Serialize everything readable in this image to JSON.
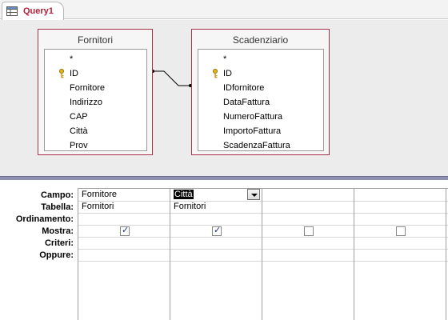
{
  "tab": {
    "label": "Query1",
    "icon": "query-icon"
  },
  "tables": [
    {
      "name": "Fornitori",
      "fields": [
        {
          "label": "*",
          "key": false
        },
        {
          "label": "ID",
          "key": true
        },
        {
          "label": "Fornitore",
          "key": false
        },
        {
          "label": "Indirizzo",
          "key": false
        },
        {
          "label": "CAP",
          "key": false
        },
        {
          "label": "Città",
          "key": false
        },
        {
          "label": "Prov",
          "key": false
        }
      ]
    },
    {
      "name": "Scadenziario",
      "fields": [
        {
          "label": "*",
          "key": false
        },
        {
          "label": "ID",
          "key": true
        },
        {
          "label": "IDfornitore",
          "key": false
        },
        {
          "label": "DataFattura",
          "key": false
        },
        {
          "label": "NumeroFattura",
          "key": false
        },
        {
          "label": "ImportoFattura",
          "key": false
        },
        {
          "label": "ScadenzaFattura",
          "key": false
        }
      ]
    }
  ],
  "grid": {
    "row_labels": [
      "Campo:",
      "Tabella:",
      "Ordinamento:",
      "Mostra:",
      "Criteri:",
      "Oppure:"
    ],
    "columns": [
      {
        "campo": "Fornitore",
        "tabella": "Fornitori",
        "mostra": true,
        "selected": false
      },
      {
        "campo": "Città",
        "tabella": "Fornitori",
        "mostra": true,
        "selected": true
      },
      {
        "campo": "",
        "tabella": "",
        "mostra": false,
        "selected": false
      },
      {
        "campo": "",
        "tabella": "",
        "mostra": false,
        "selected": false
      }
    ]
  },
  "colors": {
    "tab_label": "#b5203a",
    "table_border": "#a8324a",
    "splitter": "#8e8fb3"
  }
}
